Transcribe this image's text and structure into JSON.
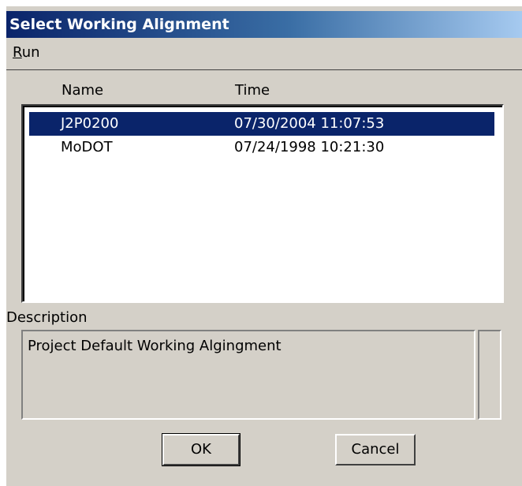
{
  "window": {
    "title": "Select Working Alignment"
  },
  "menu": {
    "run_accel": "R",
    "run_rest": "un"
  },
  "list": {
    "columns": {
      "name": "Name",
      "time": "Time"
    },
    "rows": [
      {
        "name": "J2P0200",
        "time": "07/30/2004 11:07:53",
        "selected": true
      },
      {
        "name": "MoDOT",
        "time": "07/24/1998 10:21:30",
        "selected": false
      }
    ]
  },
  "description": {
    "label": "Description",
    "value": "Project Default Working Algingment"
  },
  "buttons": {
    "ok": "OK",
    "cancel": "Cancel"
  }
}
